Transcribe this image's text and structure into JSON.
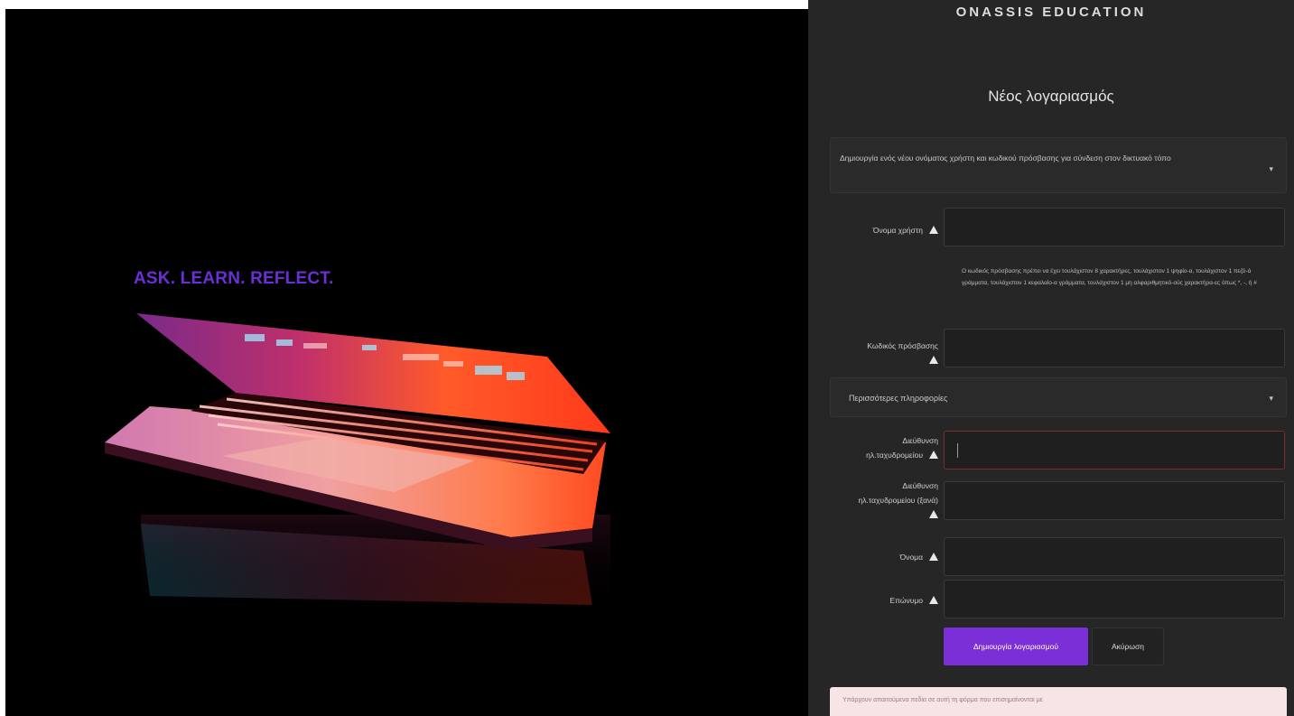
{
  "hero": {
    "tagline": "ASK. LEARN. REFLECT."
  },
  "panel": {
    "brand": "ONASSIS EDUCATION",
    "title": "Νέος λογαριασμός",
    "intro_section": {
      "text": "Δημιουργία ενός νέου ονόματος χρήστη και κωδικού πρόσβασης για σύνδεση στον δικτυακό τόπο",
      "chevron": "chevron-down-icon"
    },
    "username": {
      "label": "Όνομα χρήστη",
      "value": ""
    },
    "password_help": "Ο κωδικός πρόσβασης πρέπει να έχει τουλάχιστον 8 χαρακτήρες, τουλάχιστον 1 ψηφίο-α, τουλάχιστον 1 πεζό-ά γράμματα, τουλάχιστον 1 κεφαλαίο-α γράμματα, τουλάχιστον 1 μη αλφαριθμητικό-ούς χαρακτήρα-ες όπως *, -, ή #",
    "password": {
      "label": "Κωδικός πρόσβασης",
      "value": ""
    },
    "more_info_section": {
      "text": "Περισσότερες πληροφορίες",
      "chevron": "chevron-down-icon"
    },
    "email": {
      "label": "Διεύθυνση ηλ.ταχυδρομείου",
      "value": ""
    },
    "email_confirm": {
      "label": "Διεύθυνση ηλ.ταχυδρομείου (ξανά)",
      "value": ""
    },
    "first_name": {
      "label": "Όνομα",
      "value": ""
    },
    "last_name": {
      "label": "Επώνυμο",
      "value": ""
    },
    "create_button": "Δημιουργία λογαριασμού",
    "cancel_button": "Ακύρωση",
    "required_notice": "Υπάρχουν απαιτούμενα πεδία σε αυτή τη φόρμα που επισημαίνονται με"
  },
  "colors": {
    "accent": "#7b2fd6",
    "panel_bg": "#262626",
    "hero_bg": "#000000",
    "invalid_border": "#7b2a2e",
    "alert_bg": "#f7e4e6"
  }
}
